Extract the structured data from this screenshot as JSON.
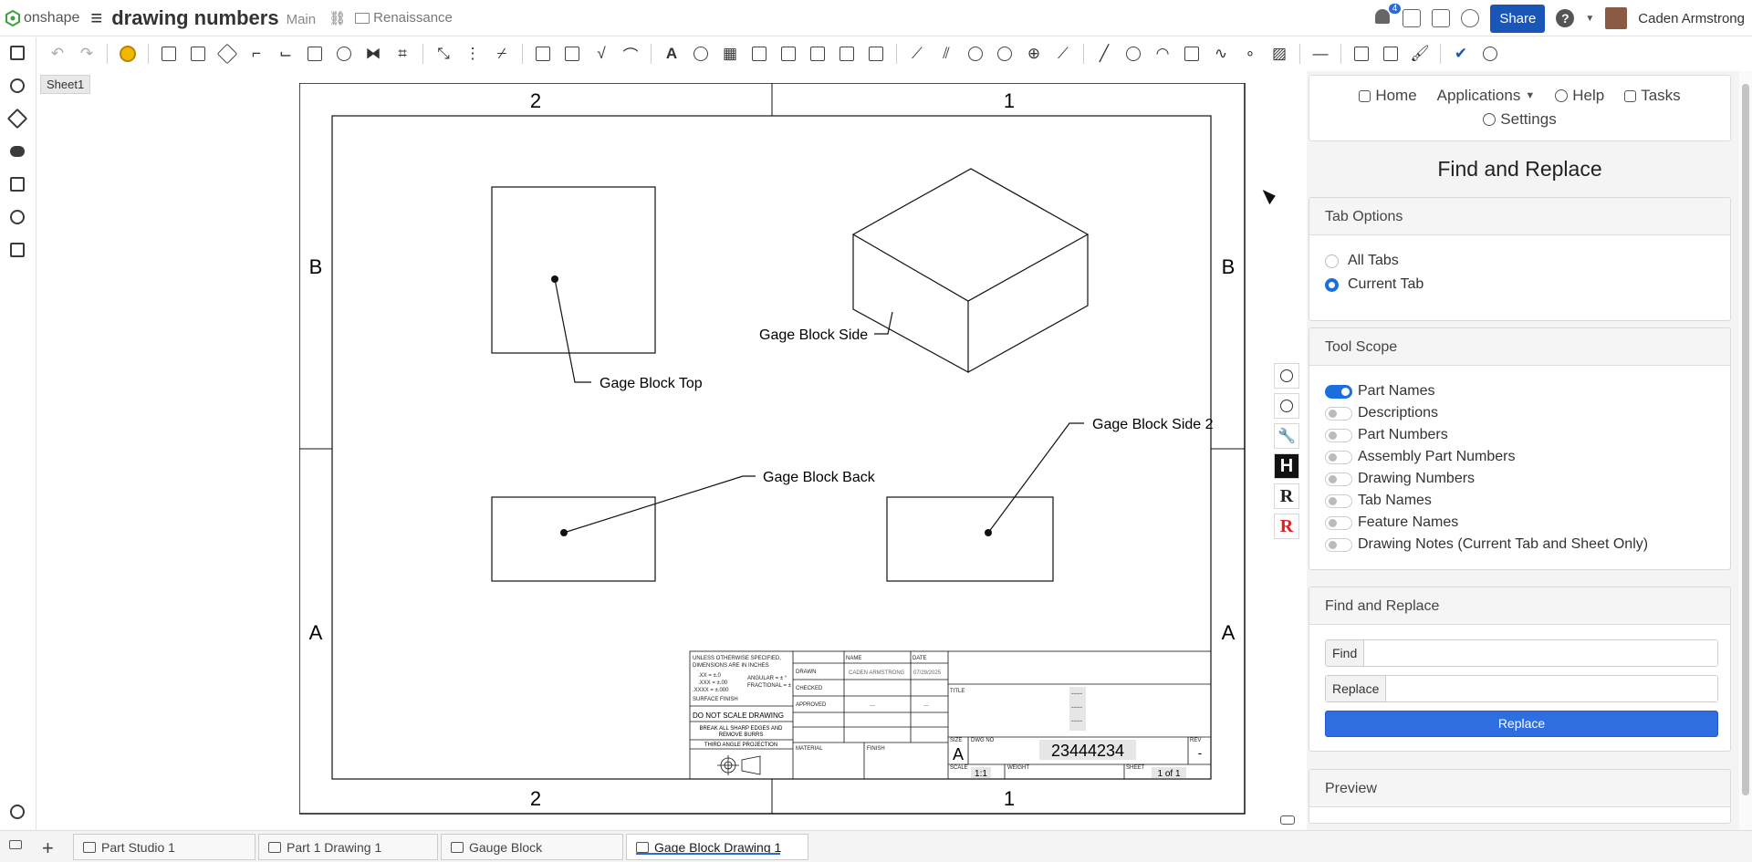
{
  "app": {
    "logo_text": "onshape",
    "doc_title": "drawing numbers",
    "branch": "Main",
    "folder": "Renaissance",
    "notification_count": "4",
    "share_label": "Share",
    "user_name": "Caden Armstrong",
    "colors": {
      "accent": "#1a56b8",
      "toggle_on": "#1a6fe0",
      "replace_button": "#2f6ee0"
    }
  },
  "sheet": {
    "name": "Sheet1"
  },
  "drawing": {
    "zone_top_left": "2",
    "zone_top_right": "1",
    "zone_bottom_left": "2",
    "zone_bottom_right": "1",
    "zone_left_b": "B",
    "zone_left_a": "A",
    "zone_right_b": "B",
    "zone_right_a": "A",
    "callouts": {
      "top": "Gage Block Top",
      "side": "Gage Block Side",
      "back": "Gage Block Back",
      "side2": "Gage Block Side 2"
    },
    "title_block": {
      "tolerance_lines": [
        "UNLESS OTHERWISE SPECIFIED,",
        "DIMENSIONS ARE IN INCHES",
        ".XX = ±.0",
        ".XXX = ±.00",
        ".XXXX = ±.000"
      ],
      "angular": "ANGULAR = ± °",
      "fractional": "FRACTIONAL = ±",
      "surface_finish": "SURFACE FINISH",
      "do_not_scale": "DO NOT SCALE DRAWING",
      "break_edges_1": "BREAK ALL SHARP EDGES AND",
      "break_edges_2": "REMOVE BURRS",
      "projection": "THIRD ANGLE PROJECTION",
      "name_header": "NAME",
      "date_header": "DATE",
      "drawn": "DRAWN",
      "drawn_name": "CADEN ARMSTRONG",
      "drawn_date": "07/29/2025",
      "checked": "CHECKED",
      "approved": "APPROVED",
      "approved_name": "---",
      "approved_date": "---",
      "material": "MATERIAL",
      "finish": "FINISH",
      "title_label": "TITLE",
      "title_dashes": [
        "----",
        "----",
        "----"
      ],
      "size_label": "SIZE",
      "size": "A",
      "dwg_no_label": "DWG NO",
      "dwg_no": "23444234",
      "rev_label": "REV",
      "rev": "-",
      "scale_label": "SCALE",
      "scale": "1:1",
      "weight_label": "WEIGHT",
      "sheet_label": "SHEET",
      "sheet_of": "1 of 1"
    }
  },
  "panel": {
    "nav": {
      "home": "Home",
      "applications": "Applications",
      "help": "Help",
      "tasks": "Tasks",
      "settings": "Settings"
    },
    "title": "Find and Replace",
    "tab_options": {
      "header": "Tab Options",
      "all_tabs": "All Tabs",
      "current_tab": "Current Tab",
      "selected": "Current Tab"
    },
    "tool_scope": {
      "header": "Tool Scope",
      "items": [
        {
          "label": "Part Names",
          "on": true
        },
        {
          "label": "Descriptions",
          "on": false
        },
        {
          "label": "Part Numbers",
          "on": false
        },
        {
          "label": "Assembly Part Numbers",
          "on": false
        },
        {
          "label": "Drawing Numbers",
          "on": false
        },
        {
          "label": "Tab Names",
          "on": false
        },
        {
          "label": "Feature Names",
          "on": false
        },
        {
          "label": "Drawing Notes (Current Tab and Sheet Only)",
          "on": false
        }
      ]
    },
    "find_replace": {
      "header": "Find and Replace",
      "find_label": "Find",
      "find_value": "",
      "replace_label": "Replace",
      "replace_value": "",
      "button": "Replace"
    },
    "preview": {
      "header": "Preview"
    }
  },
  "tabs": [
    {
      "label": "Part Studio 1"
    },
    {
      "label": "Part 1 Drawing 1"
    },
    {
      "label": "Gauge Block"
    },
    {
      "label": "Gage Block Drawing 1"
    }
  ]
}
